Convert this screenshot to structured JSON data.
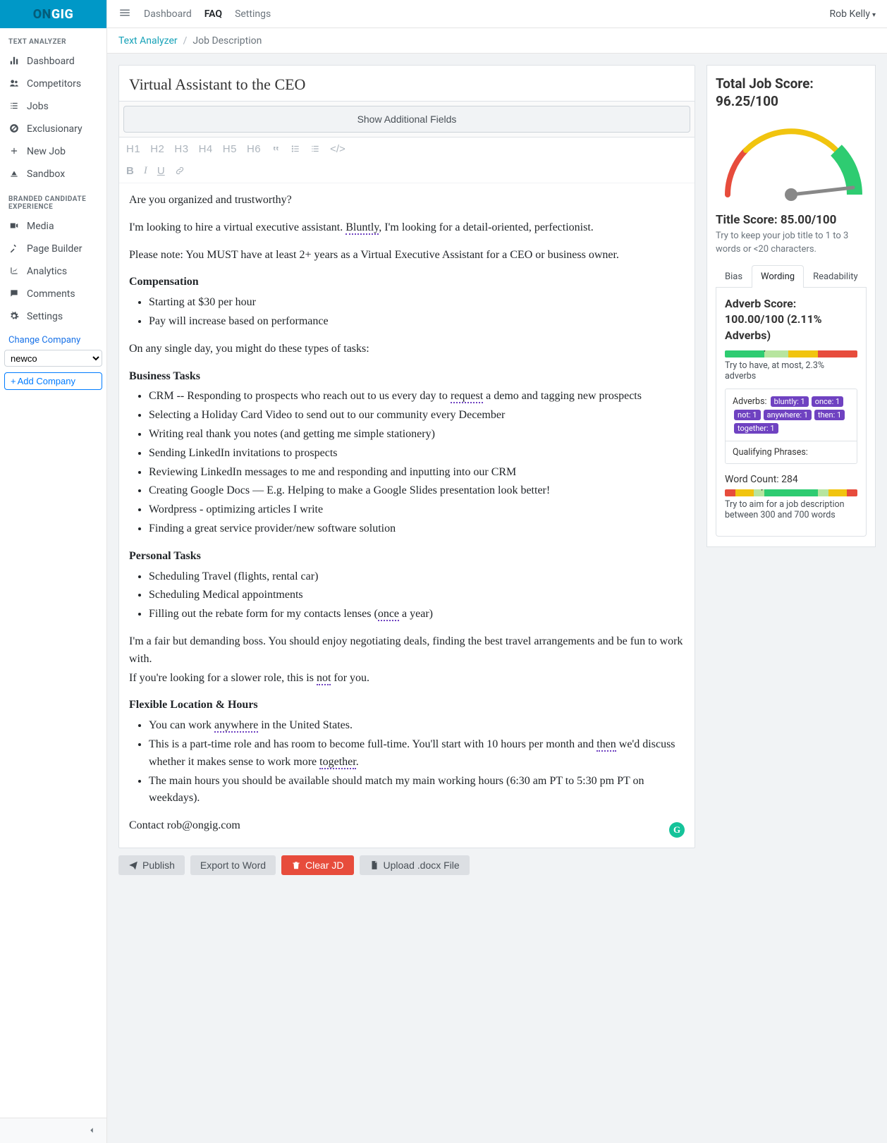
{
  "brand": {
    "part1": "ON",
    "part2": "GIG"
  },
  "topnav": {
    "dashboard": "Dashboard",
    "faq": "FAQ",
    "settings": "Settings"
  },
  "user": {
    "name": "Rob Kelly"
  },
  "breadcrumb": {
    "root": "Text Analyzer",
    "current": "Job Description"
  },
  "sidebar": {
    "section1": "TEXT ANALYZER",
    "items1": [
      {
        "label": "Dashboard"
      },
      {
        "label": "Competitors"
      },
      {
        "label": "Jobs"
      },
      {
        "label": "Exclusionary"
      },
      {
        "label": "New Job"
      },
      {
        "label": "Sandbox"
      }
    ],
    "section2": "BRANDED CANDIDATE EXPERIENCE",
    "items2": [
      {
        "label": "Media"
      },
      {
        "label": "Page Builder"
      },
      {
        "label": "Analytics"
      },
      {
        "label": "Comments"
      },
      {
        "label": "Settings"
      }
    ],
    "change_company": "Change Company",
    "company_selected": "newco",
    "add_company": "Add Company"
  },
  "editor": {
    "title": "Virtual Assistant to the CEO",
    "show_fields": "Show Additional Fields",
    "toolbar": {
      "h1": "H1",
      "h2": "H2",
      "h3": "H3",
      "h4": "H4",
      "h5": "H5",
      "h6": "H6",
      "quote": "❝",
      "ul": "≡",
      "ol": "≡",
      "code": "</>",
      "bold": "B",
      "italic": "I",
      "underline": "U",
      "link": "🔗"
    },
    "body": {
      "p1": "Are you organized and trustworthy?",
      "p2a": "I'm looking to hire a virtual executive assistant. ",
      "p2_hl": "Bluntly",
      "p2b": ", I'm looking for a detail-oriented, perfectionist.",
      "p3": "Please note: You MUST have at least 2+ years as a Virtual Executive Assistant for a CEO or business owner.",
      "h_comp": "Compensation",
      "comp": [
        "Starting at $30 per hour",
        "Pay will increase based on performance"
      ],
      "p4": "On any single day, you might do these types of tasks:",
      "h_biz": "Business Tasks",
      "biz_0a": "CRM -- Responding to prospects who reach out to us every day to ",
      "biz_0_hl": "request",
      "biz_0b": " a demo and tagging new prospects",
      "biz_rest": [
        "Selecting a Holiday Card Video to send out to our community every December",
        "Writing real thank you notes (and getting me simple stationery)",
        "Sending LinkedIn invitations to prospects",
        "Reviewing LinkedIn messages to me and responding and inputting into our CRM",
        "Creating Google Docs — E.g. Helping to make a Google Slides presentation look better!",
        "Wordpress - optimizing articles I write",
        "Finding a great service provider/new software solution"
      ],
      "h_personal": "Personal Tasks",
      "personal_0": "Scheduling Travel (flights, rental car)",
      "personal_1": "Scheduling Medical appointments",
      "personal_2a": "Filling out the rebate form for my contacts lenses (",
      "personal_2_hl": "once",
      "personal_2b": " a year)",
      "p5": "I'm a fair but demanding boss. You should enjoy negotiating deals, finding the best travel arrangements and be fun to work with.",
      "p6a": "If you're looking for a slower role, this is ",
      "p6_hl": "not",
      "p6b": " for you.",
      "h_flex": "Flexible Location & Hours",
      "flex_0a": "You can work ",
      "flex_0_hl": "anywhere",
      "flex_0b": " in the United States.",
      "flex_1a": "This is a part-time role and has room to become full-time. You'll start with 10 hours per month and ",
      "flex_1_hl1": "then",
      "flex_1b": " we'd discuss whether it makes sense to work more ",
      "flex_1_hl2": "together",
      "flex_1c": ".",
      "flex_2": "The main hours you should be available should match my main working hours (6:30 am PT to 5:30 pm PT on weekdays).",
      "contact": "Contact rob@ongig.com"
    }
  },
  "actions": {
    "publish": "Publish",
    "export": "Export to Word",
    "clear": "Clear JD",
    "upload": "Upload .docx File"
  },
  "score": {
    "total_label": "Total Job Score: 96.25/100",
    "title_label": "Title Score: 85.00/100",
    "title_help": "Try to keep your job title to 1 to 3 words or <20 characters.",
    "tabs": {
      "bias": "Bias",
      "wording": "Wording",
      "readability": "Readability"
    },
    "adverb_title": "Adverb Score: 100.00/100 (2.11% Adverbs)",
    "adverb_help": "Try to have, at most, 2.3% adverbs",
    "adverb_label": "Adverbs:",
    "adverb_pills": [
      "bluntly: 1",
      "once: 1",
      "not: 1",
      "anywhere: 1",
      "then: 1",
      "together: 1"
    ],
    "qualifying_label": "Qualifying Phrases:",
    "word_count_label": "Word Count: 284",
    "word_count_help": "Try to aim for a job description between 300 and 700 words"
  },
  "chart_data": {
    "type": "gauge",
    "value": 96.25,
    "min": 0,
    "max": 100,
    "segments": [
      {
        "from": 0,
        "to": 33,
        "color": "#e74c3c"
      },
      {
        "from": 33,
        "to": 66,
        "color": "#f1c40f"
      },
      {
        "from": 66,
        "to": 100,
        "color": "#2ecc71"
      }
    ],
    "title": "Total Job Score"
  }
}
